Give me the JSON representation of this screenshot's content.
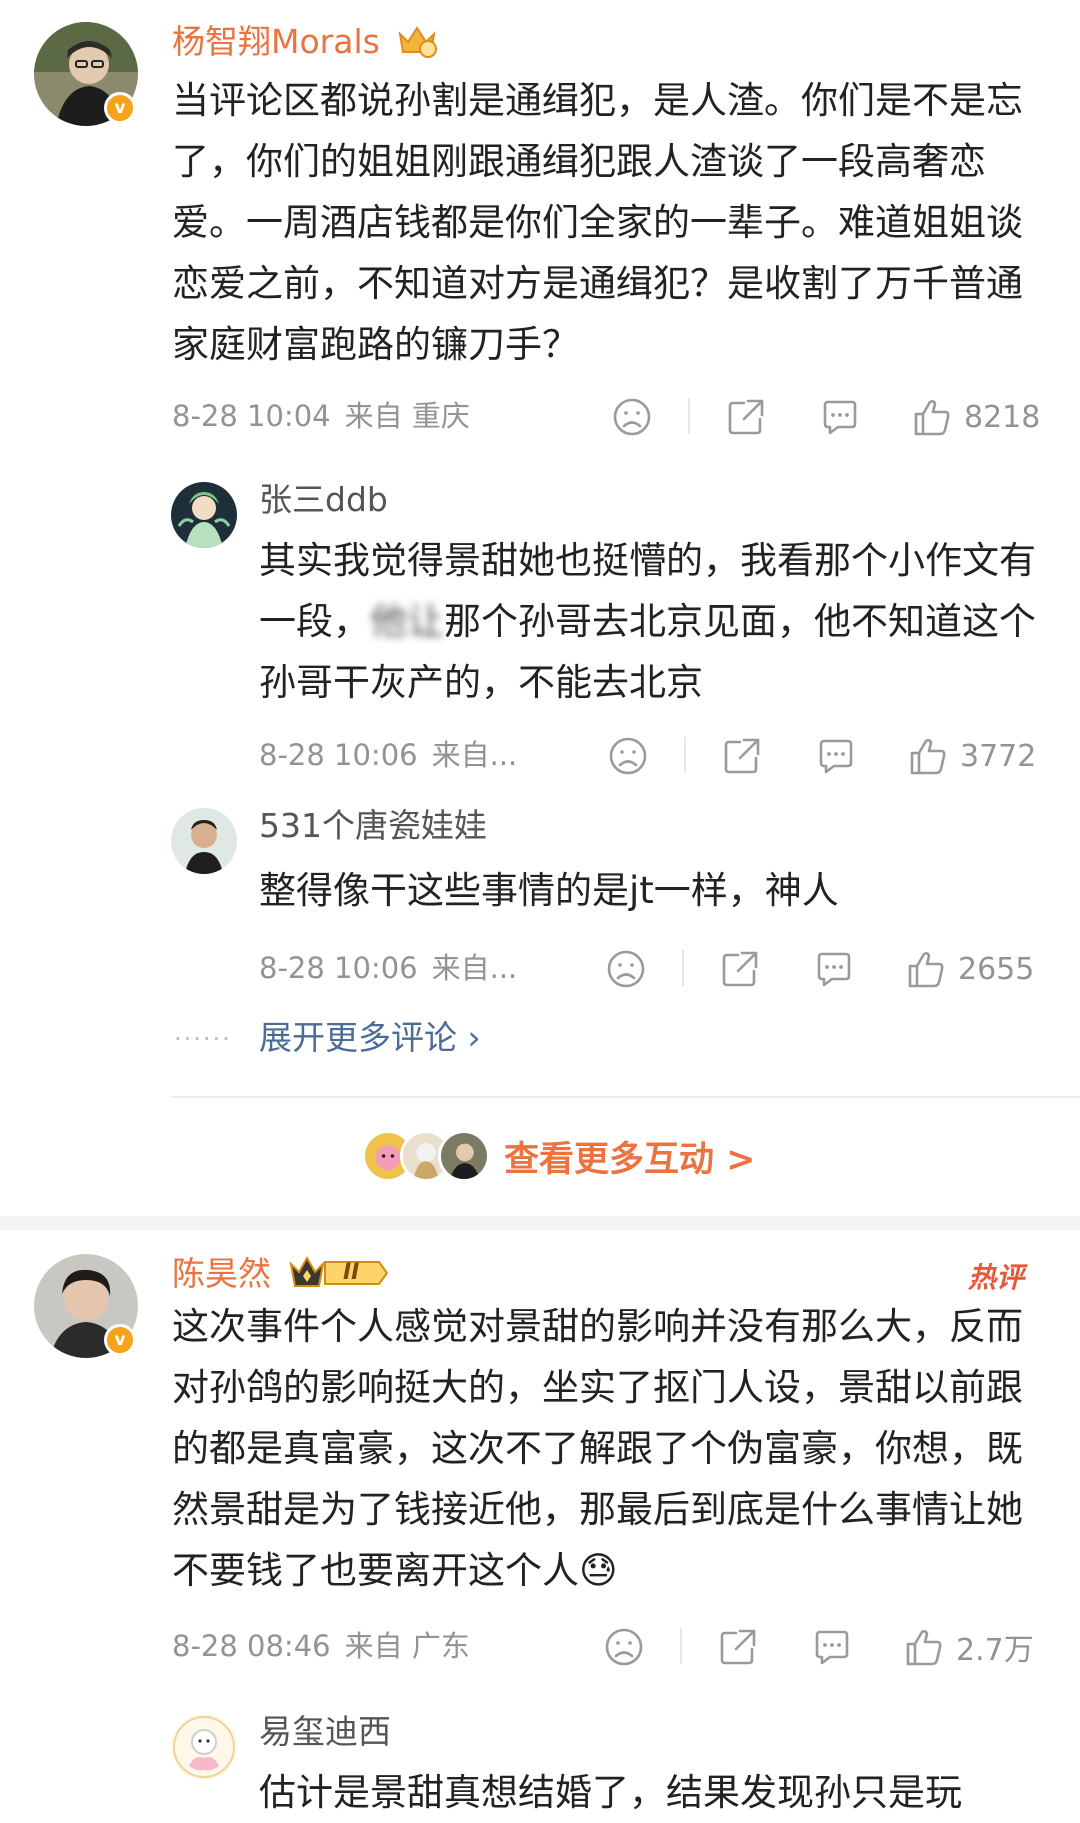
{
  "comments": [
    {
      "username": "杨智翔Morals",
      "text": "当评论区都说孙割是通缉犯，是人渣。你们是不是忘了，你们的姐姐刚跟通缉犯跟人渣谈了一段高奢恋爱。一周酒店钱都是你们全家的一辈子。难道姐姐谈恋爱之前，不知道对方是通缉犯？是收割了万千普通家庭财富跑路的镰刀手？",
      "time": "8-28 10:04",
      "source": "来自 重庆",
      "likes": "8218",
      "verified_badge": "v",
      "replies": [
        {
          "username": "张三ddb",
          "text_a": "其实我觉得景甜她也挺懵的，我看那个小作文有一段，",
          "text_blur": "他让",
          "text_b": "那个孙哥去北京见面，他不知道这个孙哥干灰产的，不能去北京",
          "time": "8-28 10:06",
          "source": "来自...",
          "likes": "3772"
        },
        {
          "username": "531个唐瓷娃娃",
          "text": "整得像干这些事情的是jt一样，神人",
          "time": "8-28 10:06",
          "source": "来自...",
          "likes": "2655"
        }
      ],
      "more_replies": "展开更多评论 ›",
      "more_dots": "······",
      "interact_label": "查看更多互动 >"
    },
    {
      "username": "陈昊然",
      "level_badge": "II",
      "hot_label": "热评",
      "text": "这次事件个人感觉对景甜的影响并没有那么大，反而对孙鸽的影响挺大的，坐实了抠门人设，景甜以前跟的都是真富豪，这次不了解跟了个伪富豪，你想，既然景甜是为了钱接近他，那最后到底是什么事情让她不要钱了也要离开这个人😓",
      "time": "8-28 08:46",
      "source": "来自 广东",
      "likes": "2.7万",
      "verified_badge": "v",
      "replies": [
        {
          "username": "易玺迪西",
          "text": "估计是景甜真想结婚了，结果发现孙只是玩"
        }
      ]
    }
  ],
  "icons": [
    "dislike-icon",
    "share-icon",
    "reply-icon",
    "like-icon"
  ],
  "colors": {
    "username_orange": "#eb7340",
    "link_blue": "#4c6b95",
    "meta_grey": "#939393",
    "hot_red": "#e8573a"
  }
}
